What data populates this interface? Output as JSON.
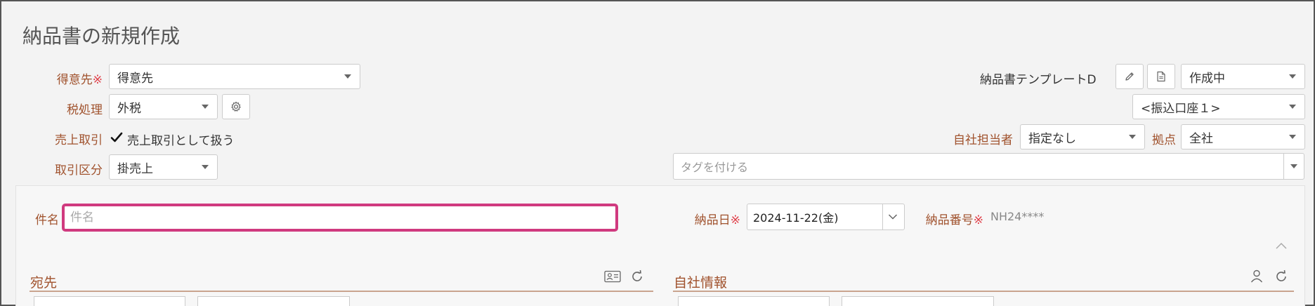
{
  "page": {
    "title": "納品書の新規作成"
  },
  "customer": {
    "label": "得意先",
    "required_mark": "※",
    "value": "得意先"
  },
  "tax": {
    "label": "税処理",
    "value": "外税"
  },
  "sales": {
    "label": "売上取引",
    "checkbox_label": "売上取引として扱う",
    "checked": true
  },
  "transaction": {
    "label": "取引区分",
    "value": "掛売上"
  },
  "template": {
    "name": "納品書テンプレートD",
    "status": "作成中"
  },
  "bank_account": {
    "value": "<振込口座１>"
  },
  "staff": {
    "label": "自社担当者",
    "value": "指定なし"
  },
  "base": {
    "label": "拠点",
    "value": "全社"
  },
  "tags": {
    "placeholder": "タグを付ける"
  },
  "subject": {
    "label": "件名",
    "placeholder": "件名",
    "value": ""
  },
  "delivery_date": {
    "label": "納品日",
    "required_mark": "※",
    "value": "2024-11-22(金)"
  },
  "delivery_number": {
    "label": "納品番号",
    "required_mark": "※",
    "value": "NH24****"
  },
  "sections": {
    "recipient": "宛先",
    "company_info": "自社情報"
  },
  "icons": {
    "edit": "pencil-icon",
    "document": "document-icon",
    "settings": "gear-icon",
    "collapse": "chevron-up-icon",
    "contact_card": "contact-card-icon",
    "refresh": "refresh-icon",
    "person": "person-icon",
    "date_dropdown": "chevron-down-icon"
  },
  "colors": {
    "label": "#a0522d",
    "required": "#e0404a",
    "focus_border": "#d03a7f"
  }
}
